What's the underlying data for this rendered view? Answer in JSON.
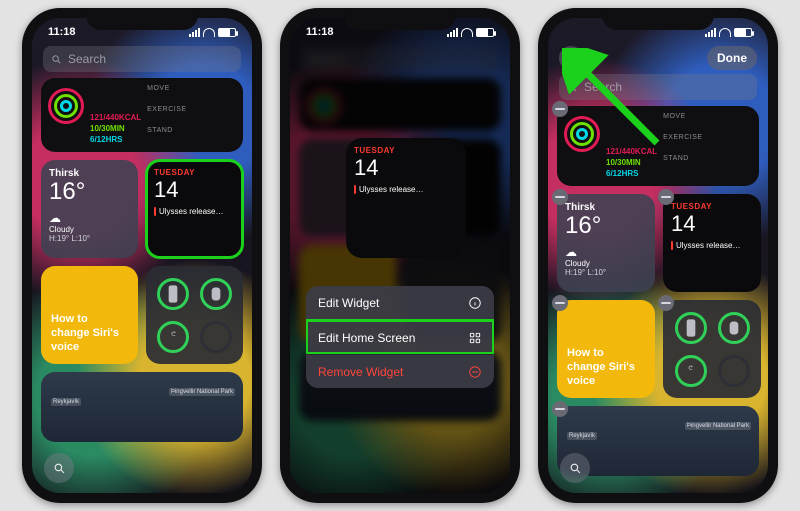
{
  "status": {
    "time": "11:18",
    "battery_pct": 70
  },
  "search": {
    "placeholder": "Search"
  },
  "editbar": {
    "add_label": "+",
    "done_label": "Done"
  },
  "fitness": {
    "move": {
      "value": "121/440",
      "unit": "KCAL",
      "label": "MOVE"
    },
    "exercise": {
      "value": "10/30",
      "unit": "MIN",
      "label": "EXERCISE"
    },
    "stand": {
      "value": "6/12",
      "unit": "HRS",
      "label": "STAND"
    }
  },
  "weather": {
    "location": "Thirsk",
    "temp": "16°",
    "condition": "Cloudy",
    "high_low": "H:19° L:10°",
    "icon_glyph": "☁︎"
  },
  "calendar": {
    "day_of_week": "TUESDAY",
    "day_number": "14",
    "event": "Ulysses release…"
  },
  "tip": {
    "text": "How to change Siri's voice"
  },
  "batteries": {
    "devices": [
      "phone",
      "watch",
      "airpods",
      "empty"
    ]
  },
  "map": {
    "labels": [
      "Reykjavík",
      "Þingvellir National Park"
    ]
  },
  "context_menu": {
    "items": [
      {
        "label": "Edit Widget",
        "icon": "info",
        "destructive": false,
        "highlighted": false
      },
      {
        "label": "Edit Home Screen",
        "icon": "apps",
        "destructive": false,
        "highlighted": true
      },
      {
        "label": "Remove Widget",
        "icon": "remove",
        "destructive": true,
        "highlighted": false
      }
    ]
  },
  "highlights": {
    "phone1_widget": "calendar",
    "phone2_menu_item": 1,
    "phone3_button": "add"
  }
}
